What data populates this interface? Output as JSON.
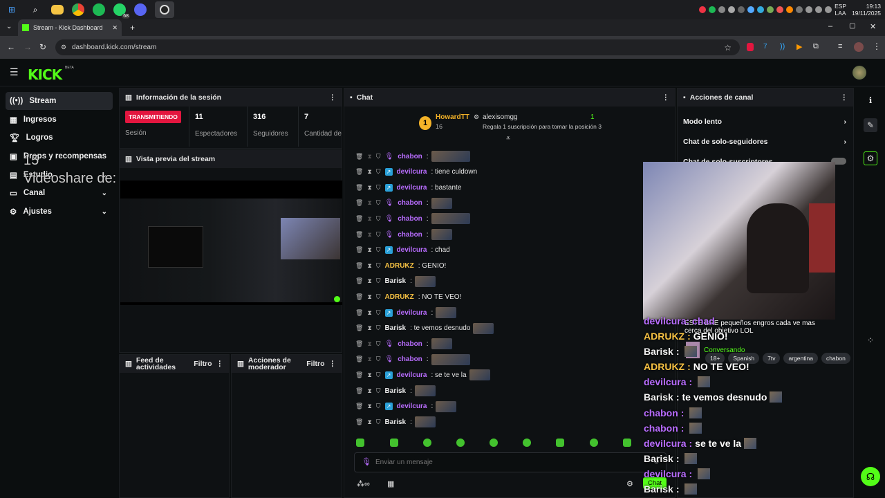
{
  "taskbar": {
    "lang": [
      "ESP",
      "LAA"
    ],
    "time": "19:13",
    "date": "19/11/2025",
    "whatsapp_badge": "68"
  },
  "browser": {
    "tab_title": "Stream - Kick Dashboard",
    "url": "dashboard.kick.com/stream",
    "new_tab": "+"
  },
  "header": {
    "logo": "KICK",
    "beta": "BETA"
  },
  "sidebar": {
    "items": [
      {
        "label": "Stream",
        "icon": "broadcast-icon"
      },
      {
        "label": "Ingresos",
        "icon": "money-icon"
      },
      {
        "label": "Logros",
        "icon": "trophy-icon"
      },
      {
        "label": "Drops y recompensas",
        "icon": "gift-icon"
      },
      {
        "label": "Estudio",
        "icon": "studio-icon"
      },
      {
        "label": "Canal",
        "icon": "channel-icon"
      },
      {
        "label": "Ajustes",
        "icon": "gear-icon"
      }
    ],
    "overlay_text": "Videoshare de:",
    "overlay_num": "15"
  },
  "session": {
    "title": "Información de la sesión",
    "status_badge": "TRANSMITIENDO",
    "status_label": "Sesión",
    "stats": [
      {
        "value": "11",
        "label": "Espectadores"
      },
      {
        "value": "316",
        "label": "Seguidores"
      },
      {
        "value": "7",
        "label": "Cantidad de suscripciones"
      }
    ]
  },
  "preview": {
    "title": "Vista previa del stream"
  },
  "feed": {
    "title": "Feed de actividades",
    "filter": "Filtro"
  },
  "mod": {
    "title": "Acciones de moderador",
    "filter": "Filtro"
  },
  "chat": {
    "title": "Chat",
    "top_gifter": {
      "rank": "1",
      "name": "HowardTT",
      "count": "16"
    },
    "sub_name": "alexisomgg",
    "sub_count": "1",
    "sub_prompt": "Regala 1 suscripción para tomar la posición 3",
    "messages": [
      {
        "user": "chabon",
        "text": "",
        "emote": "wide",
        "color": "#b96dff",
        "badge": "mic"
      },
      {
        "user": "devilcura",
        "text": ": tiene culdown",
        "emote": "",
        "color": "#b96dff",
        "badge": "vip"
      },
      {
        "user": "devilcura",
        "text": ": bastante",
        "emote": "",
        "color": "#b96dff",
        "badge": "vip"
      },
      {
        "user": "chabon",
        "text": "",
        "emote": "small",
        "color": "#b96dff",
        "badge": "mic"
      },
      {
        "user": "chabon",
        "text": "",
        "emote": "wide",
        "color": "#b96dff",
        "badge": "mic"
      },
      {
        "user": "chabon",
        "text": "",
        "emote": "small",
        "color": "#b96dff",
        "badge": "mic"
      },
      {
        "user": "devilcura",
        "text": ": chad",
        "emote": "",
        "color": "#b96dff",
        "badge": "vip"
      },
      {
        "user": "ADRUKZ",
        "text": ": GENIO!",
        "emote": "",
        "color": "#f7c243",
        "badge": ""
      },
      {
        "user": "Barisk",
        "text": ":",
        "emote": "small",
        "color": "#e8e8e8",
        "badge": ""
      },
      {
        "user": "ADRUKZ",
        "text": ": NO TE VEO!",
        "emote": "",
        "color": "#f7c243",
        "badge": ""
      },
      {
        "user": "devilcura",
        "text": ":",
        "emote": "small",
        "color": "#b96dff",
        "badge": "vip"
      },
      {
        "user": "Barisk",
        "text": ": te vemos desnudo",
        "emote": "small",
        "color": "#e8e8e8",
        "badge": ""
      },
      {
        "user": "chabon",
        "text": "",
        "emote": "small",
        "color": "#b96dff",
        "badge": "mic"
      },
      {
        "user": "chabon",
        "text": "",
        "emote": "wide",
        "color": "#b96dff",
        "badge": "mic"
      },
      {
        "user": "devilcura",
        "text": ": se te ve la",
        "emote": "small",
        "color": "#b96dff",
        "badge": "vip"
      },
      {
        "user": "Barisk",
        "text": ":",
        "emote": "small",
        "color": "#e8e8e8",
        "badge": ""
      },
      {
        "user": "devilcura",
        "text": ":",
        "emote": "small",
        "color": "#b96dff",
        "badge": "vip"
      },
      {
        "user": "Barisk",
        "text": ":",
        "emote": "small",
        "color": "#e8e8e8",
        "badge": ""
      }
    ],
    "input_placeholder": "Enviar un mensaje",
    "chat_button": "Chat"
  },
  "actions": {
    "title": "Acciones de canal",
    "items": [
      "Modo lento",
      "Chat de solo-seguidores",
      "Chat de solo-suscriptores"
    ]
  },
  "overlay": {
    "top_line": "ESTE BRE pequeños engros cada ve mas",
    "top_line2": "cerca del objetivo LOL",
    "category": "Conversando",
    "tags": [
      "18+",
      "Spanish",
      "7tv",
      "argentina",
      "chabon"
    ],
    "lines": [
      {
        "user": "ADRUKZ",
        "text": "GENIO!",
        "color": "#f7c243"
      },
      {
        "user": "Barisk",
        "text": "",
        "color": "#f0f0f0"
      },
      {
        "user": "ADRUKZ",
        "text": "NO TE VEO!",
        "color": "#f7c243"
      },
      {
        "user": "devilcura",
        "text": "",
        "color": "#b96dff"
      },
      {
        "user": "Barisk",
        "text": "te vemos desnudo",
        "color": "#f0f0f0"
      },
      {
        "user": "chabon",
        "text": "",
        "color": "#b96dff"
      },
      {
        "user": "chabon",
        "text": "",
        "color": "#b96dff"
      },
      {
        "user": "devilcura",
        "text": "se te ve la",
        "color": "#b96dff"
      },
      {
        "user": "Barisk",
        "text": "",
        "color": "#f0f0f0"
      },
      {
        "user": "devilcura",
        "text": "",
        "color": "#b96dff"
      },
      {
        "user": "Barisk",
        "text": "",
        "color": "#f0f0f0"
      }
    ],
    "prefix_top": "devilcura: chad"
  },
  "colors": {
    "accent": "#53fc18",
    "live": "#e3163f",
    "sub": "#b96dff"
  }
}
